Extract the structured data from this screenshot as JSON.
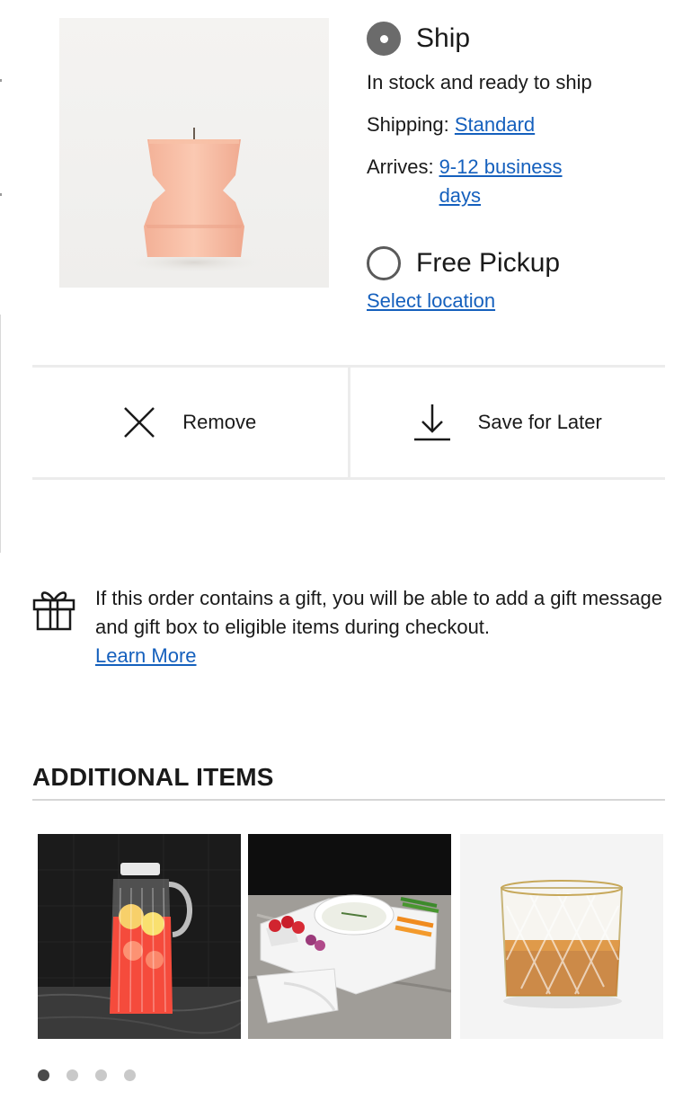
{
  "product": {
    "image_alt": "Peach pillar candle"
  },
  "fulfillment": {
    "ship_label": "Ship",
    "stock_status": "In stock and ready to ship",
    "shipping_prefix": "Shipping:",
    "shipping_method": "Standard",
    "arrives_prefix": "Arrives:",
    "arrives_value": "9-12 business days",
    "pickup_label": "Free Pickup",
    "select_location": "Select location",
    "selected_option": "Ship"
  },
  "actions": {
    "remove_label": "Remove",
    "save_label": "Save for Later"
  },
  "gift": {
    "message": "If this order contains a gift, you will be able to add a gift message and gift box to eligible items during checkout.",
    "learn_more": "Learn More"
  },
  "additional": {
    "title": "ADDITIONAL ITEMS",
    "items": [
      "glass-pitcher",
      "serving-platter",
      "whiskey-glass"
    ],
    "carousel_pages": 4,
    "active_page": 1
  }
}
